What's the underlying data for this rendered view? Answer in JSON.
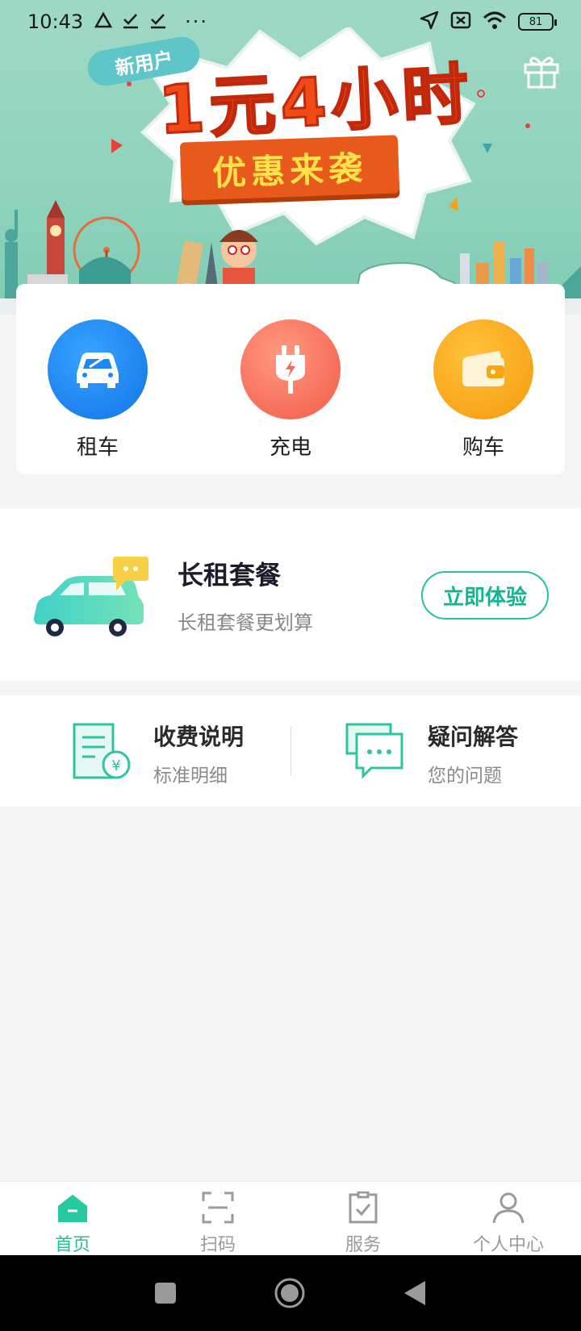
{
  "status_bar": {
    "time": "10:43",
    "dots": "···",
    "battery": "81"
  },
  "banner": {
    "badge": "新用户",
    "headline": "1元4小时",
    "ribbon": "优惠来袭"
  },
  "quick_menu": [
    {
      "label": "租车",
      "icon": "car-icon",
      "color": "#1f86f5"
    },
    {
      "label": "充电",
      "icon": "plug-icon",
      "color": "#f6695a"
    },
    {
      "label": "购车",
      "icon": "wallet-icon",
      "color": "#f7a712"
    }
  ],
  "long_rent": {
    "title": "长租套餐",
    "subtitle": "长租套餐更划算",
    "button": "立即体验"
  },
  "info": [
    {
      "title": "收费说明",
      "subtitle": "标准明细",
      "icon": "fee-document-icon"
    },
    {
      "title": "疑问解答",
      "subtitle": "您的问题",
      "icon": "chat-bubbles-icon"
    }
  ],
  "bottom_nav": [
    {
      "label": "首页",
      "icon": "home-icon",
      "active": true
    },
    {
      "label": "扫码",
      "icon": "scan-icon",
      "active": false
    },
    {
      "label": "服务",
      "icon": "service-clipboard-icon",
      "active": false
    },
    {
      "label": "个人中心",
      "icon": "person-icon",
      "active": false
    }
  ],
  "colors": {
    "accent": "#1fbf98",
    "banner_bg": "#9fd9c5",
    "promo_red": "#f04a16"
  }
}
